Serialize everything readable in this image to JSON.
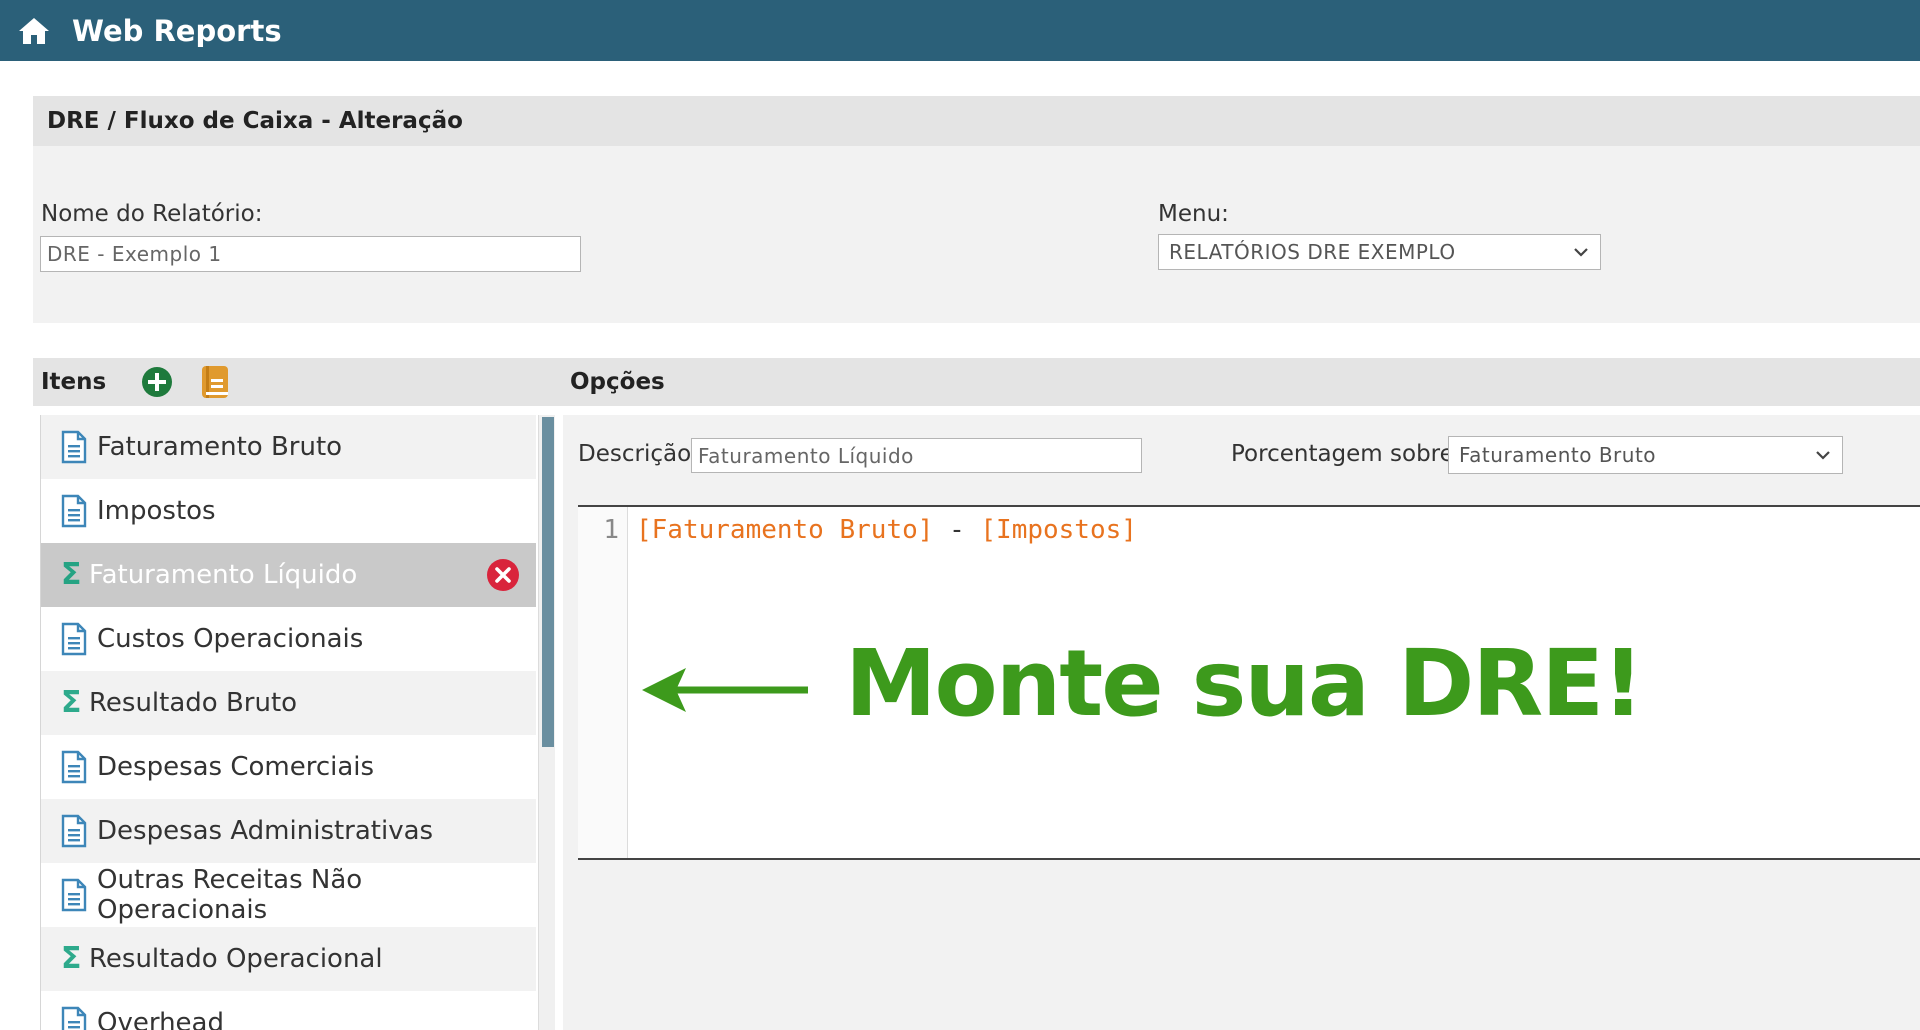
{
  "app": {
    "title": "Web Reports"
  },
  "form": {
    "header_title": "DRE / Fluxo de Caixa - Alteração",
    "report_name_label": "Nome do Relatório:",
    "report_name_value": "DRE - Exemplo 1",
    "menu_label": "Menu:",
    "menu_value": "RELATÓRIOS DRE EXEMPLO"
  },
  "items_panel": {
    "title": "Itens",
    "items": [
      {
        "label": "Faturamento Bruto",
        "icon": "document-icon"
      },
      {
        "label": "Impostos",
        "icon": "document-icon"
      },
      {
        "label": "Faturamento Líquido",
        "icon": "sigma-icon",
        "selected": true
      },
      {
        "label": "Custos Operacionais",
        "icon": "document-icon"
      },
      {
        "label": "Resultado Bruto",
        "icon": "sigma-icon"
      },
      {
        "label": "Despesas Comerciais",
        "icon": "document-icon"
      },
      {
        "label": "Despesas Administrativas",
        "icon": "document-icon"
      },
      {
        "label": "Outras Receitas Não Operacionais",
        "icon": "document-icon"
      },
      {
        "label": "Resultado Operacional",
        "icon": "sigma-icon"
      },
      {
        "label": "Overhead",
        "icon": "document-icon"
      }
    ]
  },
  "options_panel": {
    "title": "Opções",
    "description_label": "Descrição:",
    "description_value": "Faturamento Líquido",
    "percentage_label": "Porcentagem sobre:",
    "percentage_value": "Faturamento Bruto"
  },
  "editor": {
    "line_number": "1",
    "ref1": "[Faturamento Bruto]",
    "operator": " - ",
    "ref2": "[Impostos]"
  },
  "callout": {
    "text": "Monte sua DRE!"
  },
  "colors": {
    "topbar": "#2b6079",
    "callout": "#3d9a1c",
    "formula_reference": "#e8731f",
    "sigma": "#2eaa8c",
    "remove": "#d9243c",
    "add": "#1e7a3c",
    "book": "#e09a2e"
  }
}
